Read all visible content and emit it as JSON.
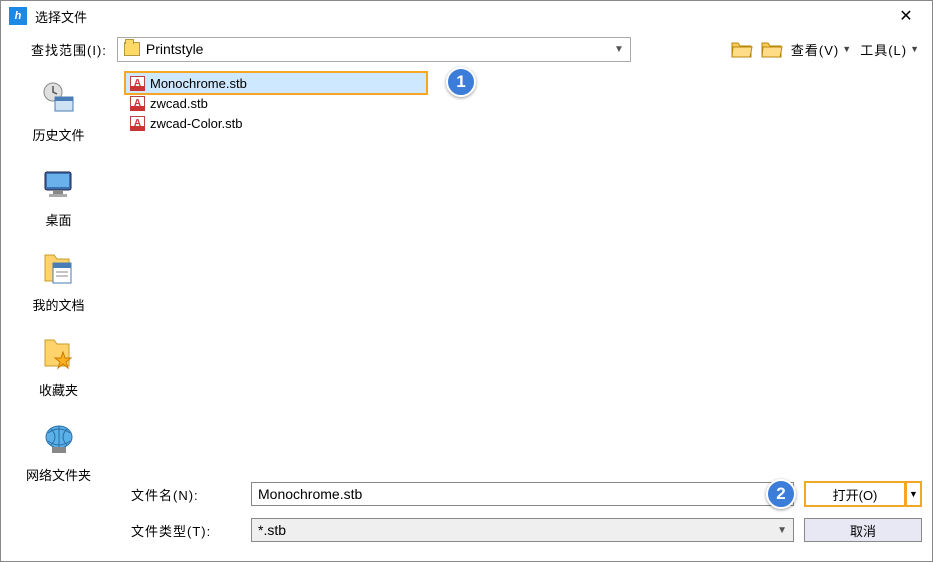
{
  "title": "选择文件",
  "lookInLabel": "查找范围(I):",
  "lookInValue": "Printstyle",
  "viewLabel": "查看(V)",
  "toolsLabel": "工具(L)",
  "sidebar": [
    {
      "label": "历史文件"
    },
    {
      "label": "桌面"
    },
    {
      "label": "我的文档"
    },
    {
      "label": "收藏夹"
    },
    {
      "label": "网络文件夹"
    }
  ],
  "files": [
    {
      "name": "Monochrome.stb"
    },
    {
      "name": "zwcad.stb"
    },
    {
      "name": "zwcad-Color.stb"
    }
  ],
  "fileNameLabel": "文件名(N):",
  "fileNameValue": "Monochrome.stb",
  "fileTypeLabel": "文件类型(T):",
  "fileTypeValue": "*.stb",
  "openLabel": "打开(O)",
  "cancelLabel": "取消",
  "callout1": "1",
  "callout2": "2"
}
